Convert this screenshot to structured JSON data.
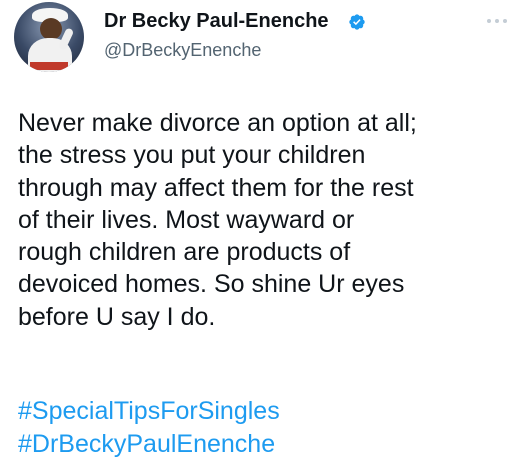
{
  "author": {
    "name": "Dr Becky Paul-Enenche",
    "handle": "@DrBeckyEnenche",
    "verified": true,
    "avatar_icon": "profile-photo"
  },
  "more_icon": "ellipsis-icon",
  "tweet": {
    "text": "Never make divorce an option at all;\nthe stress you put your children\nthrough may affect them for the rest\nof their lives. Most wayward or\nrough children are products of\ndevoiced homes. So shine Ur eyes\nbefore U say I do.",
    "hashtags": [
      "#SpecialTipsForSingles",
      "#DrBeckyPaulEnenche"
    ]
  },
  "colors": {
    "text": "#0f1419",
    "secondary": "#536471",
    "link": "#1d9bf0",
    "verified": "#1d9bf0"
  }
}
